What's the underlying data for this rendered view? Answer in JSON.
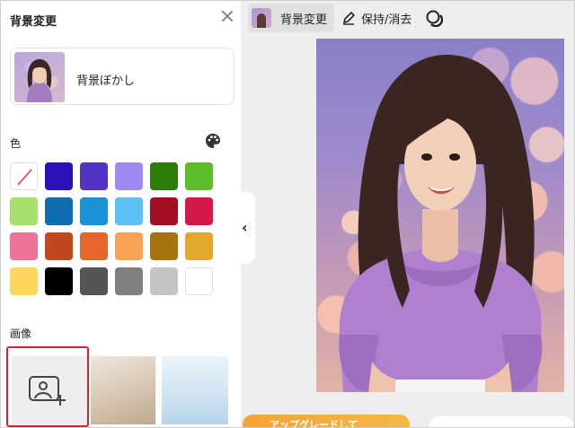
{
  "panel": {
    "title": "背景変更",
    "blur_option_label": "背景ぼかし",
    "color_section_label": "色",
    "image_section_label": "画像"
  },
  "colors": [
    "none",
    "#2a11b8",
    "#5433c4",
    "#a088f3",
    "#2c7d0a",
    "#5ebd2b",
    "#a6e06a",
    "#0f6db0",
    "#1a92d9",
    "#5ec0f2",
    "#a30d24",
    "#d4184a",
    "#ee7295",
    "#c1471f",
    "#e8652a",
    "#f9a454",
    "#a8720e",
    "#e3a82b",
    "#fcd75a",
    "#000000",
    "#555555",
    "#808080",
    "#c4c4c4",
    "#ffffff"
  ],
  "images": {
    "items": [
      "upload",
      "beige",
      "sky"
    ]
  },
  "toolbar": {
    "bg_change_label": "背景変更",
    "keep_erase_label": "保持/消去"
  },
  "bottom": {
    "upgrade_label": "アップグレードして"
  }
}
